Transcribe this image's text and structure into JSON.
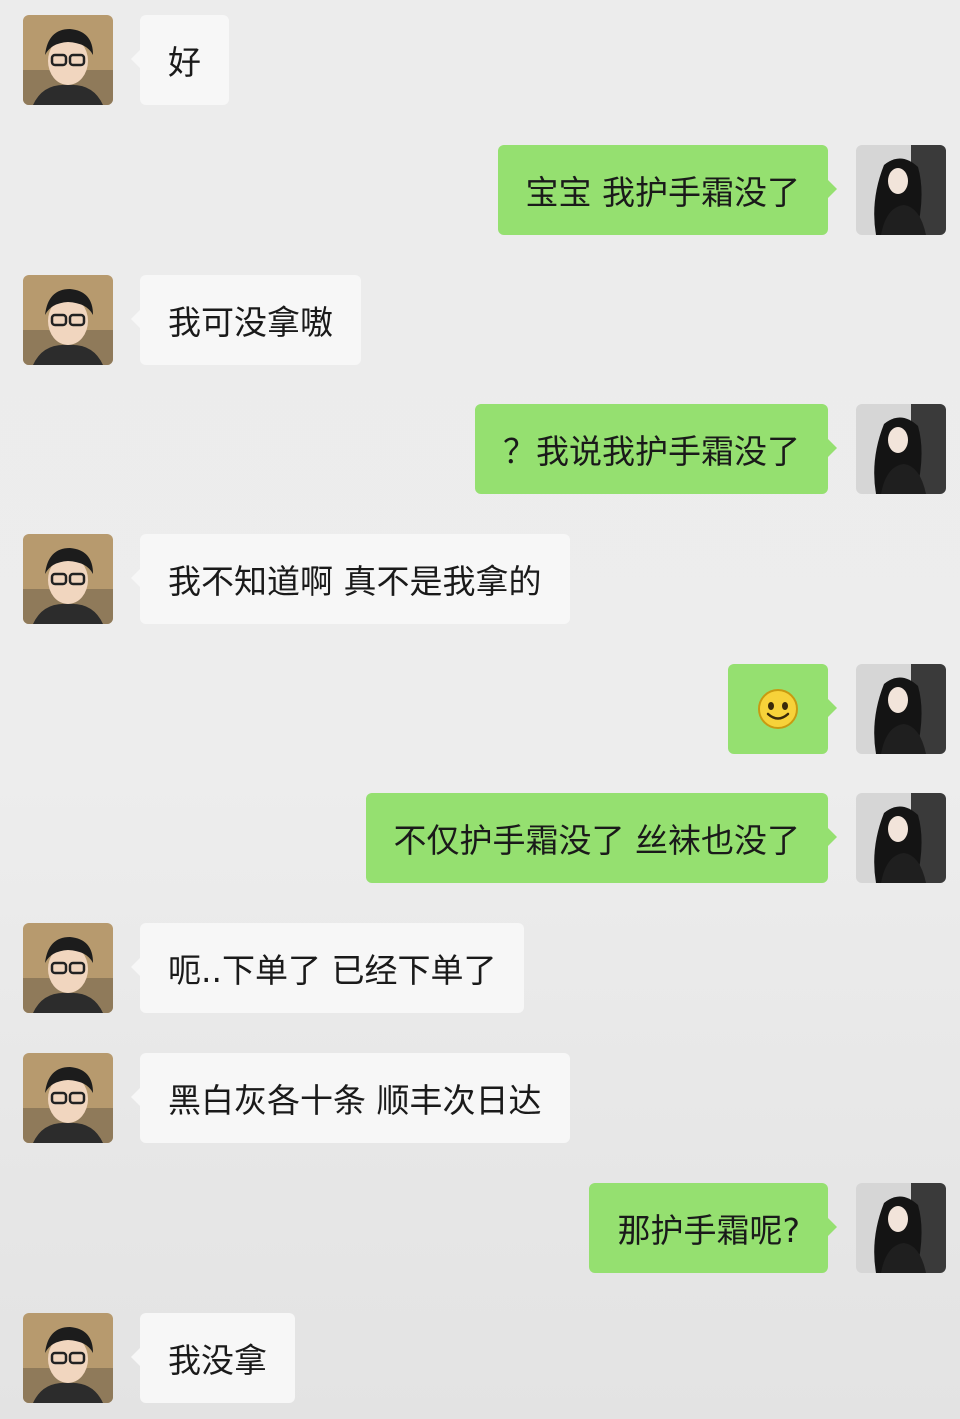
{
  "messages": [
    {
      "side": "left",
      "text": "好"
    },
    {
      "side": "right",
      "text": "宝宝 我护手霜没了"
    },
    {
      "side": "left",
      "text": "我可没拿嗷"
    },
    {
      "side": "right",
      "text": "？我说我护手霜没了"
    },
    {
      "side": "left",
      "text": "我不知道啊 真不是我拿的"
    },
    {
      "side": "right",
      "emoji": "smile-emoji"
    },
    {
      "side": "right",
      "text": "不仅护手霜没了 丝袜也没了"
    },
    {
      "side": "left",
      "text": "呃..下单了 已经下单了"
    },
    {
      "side": "left",
      "text": "黑白灰各十条 顺丰次日达"
    },
    {
      "side": "right",
      "text": "那护手霜呢?"
    },
    {
      "side": "left",
      "text": "我没拿"
    }
  ],
  "colors": {
    "incoming_bubble": "#f7f7f7",
    "outgoing_bubble": "#95e070",
    "background": "#ededed"
  }
}
